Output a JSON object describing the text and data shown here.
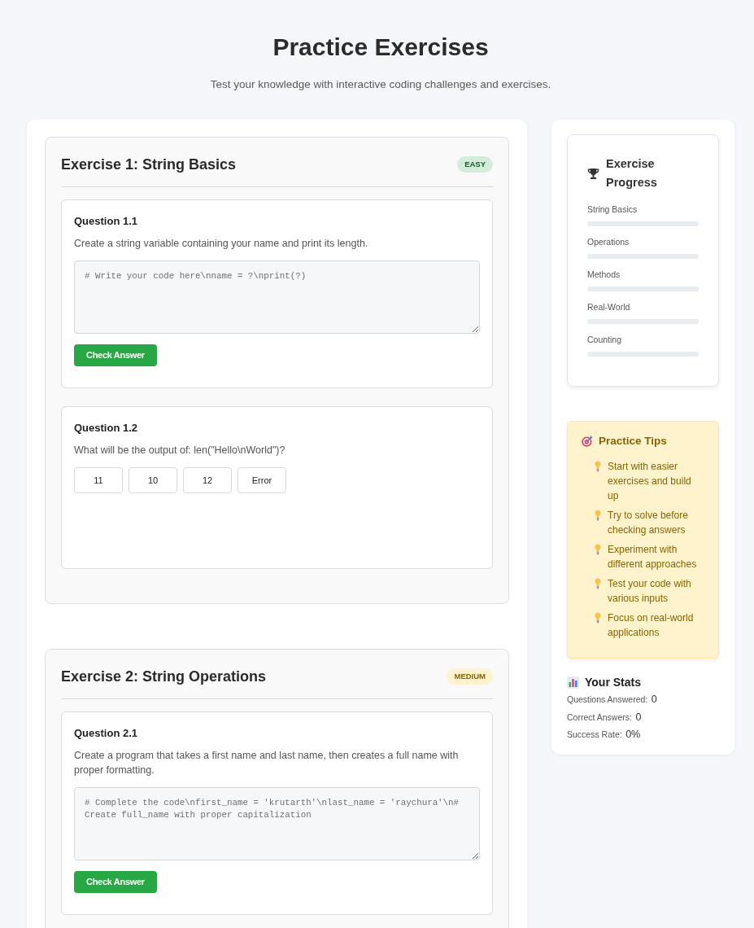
{
  "page": {
    "title": "Practice Exercises",
    "subtitle": "Test your knowledge with interactive coding challenges and exercises."
  },
  "exercises": [
    {
      "title": "Exercise 1: String Basics",
      "difficulty": {
        "kind": "easy",
        "label": "EASY"
      },
      "questions": [
        {
          "kind": "code",
          "title": "Question 1.1",
          "prompt": "Create a string variable containing your name and print its length.",
          "placeholder": "# Write your code here\\nname = ?\\nprint(?)",
          "button": "Check Answer"
        },
        {
          "kind": "choice",
          "title": "Question 1.2",
          "prompt": "What will be the output of: len(\"Hello\\nWorld\")?",
          "options": [
            "11",
            "10",
            "12",
            "Error"
          ]
        }
      ]
    },
    {
      "title": "Exercise 2: String Operations",
      "difficulty": {
        "kind": "medium",
        "label": "MEDIUM"
      },
      "questions": [
        {
          "kind": "code",
          "title": "Question 2.1",
          "prompt": "Create a program that takes a first name and last name, then creates a full name with proper formatting.",
          "placeholder": "# Complete the code\\nfirst_name = 'krutarth'\\nlast_name = 'raychura'\\n# Create full_name with proper capitalization",
          "button": "Check Answer"
        }
      ]
    }
  ],
  "progress": {
    "title": "Exercise Progress",
    "items": [
      {
        "label": "String Basics",
        "level": 0
      },
      {
        "label": "Operations",
        "level": 0
      },
      {
        "label": "Methods",
        "level": 0
      },
      {
        "label": "Real-World",
        "level": 0
      },
      {
        "label": "Counting",
        "level": 0
      }
    ]
  },
  "tips": {
    "title": "Practice Tips",
    "items": [
      "Start with easier exercises and build up",
      "Try to solve before checking answers",
      "Experiment with different approaches",
      "Test your code with various inputs",
      "Focus on real-world applications"
    ]
  },
  "stats": {
    "title": "Your Stats",
    "items": [
      {
        "label": "Questions Answered:",
        "value": "0"
      },
      {
        "label": "Correct Answers:",
        "value": "0"
      },
      {
        "label": "Success Rate:",
        "value": "0%"
      }
    ]
  }
}
